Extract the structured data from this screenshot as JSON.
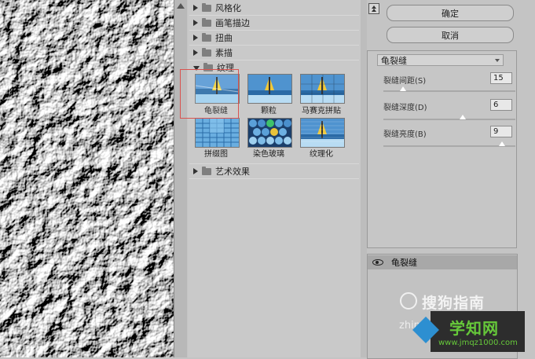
{
  "gallery": {
    "categories_top": [
      {
        "label": "风格化",
        "expanded": false
      },
      {
        "label": "画笔描边",
        "expanded": false
      },
      {
        "label": "扭曲",
        "expanded": false
      },
      {
        "label": "素描",
        "expanded": false
      },
      {
        "label": "纹理",
        "expanded": true
      }
    ],
    "textures": [
      {
        "label": "龟裂缝",
        "selected": true
      },
      {
        "label": "颗粒",
        "selected": false
      },
      {
        "label": "马赛克拼贴",
        "selected": false
      },
      {
        "label": "拼缀图",
        "selected": false
      },
      {
        "label": "染色玻璃",
        "selected": false
      },
      {
        "label": "纹理化",
        "selected": false
      }
    ],
    "category_bottom": {
      "label": "艺术效果",
      "expanded": false
    }
  },
  "buttons": {
    "ok": "确定",
    "cancel": "取消"
  },
  "filter": {
    "selected": "龟裂缝",
    "params": [
      {
        "label": "裂缝间距(S)",
        "value": "15",
        "level_fraction": 0.15
      },
      {
        "label": "裂缝深度(D)",
        "value": "6",
        "level_fraction": 0.6
      },
      {
        "label": "裂缝亮度(B)",
        "value": "9",
        "level_fraction": 0.9
      }
    ]
  },
  "layers": {
    "active": "龟裂缝"
  },
  "watermarks": {
    "sogou": "搜狗指南",
    "sogou_url": "zhin",
    "xuezhi": "学知网",
    "xuezhi_url": "www.jmqz1000.com"
  },
  "colors": {
    "selection_border": "#d9534f",
    "watermark_green": "#66c83a"
  }
}
